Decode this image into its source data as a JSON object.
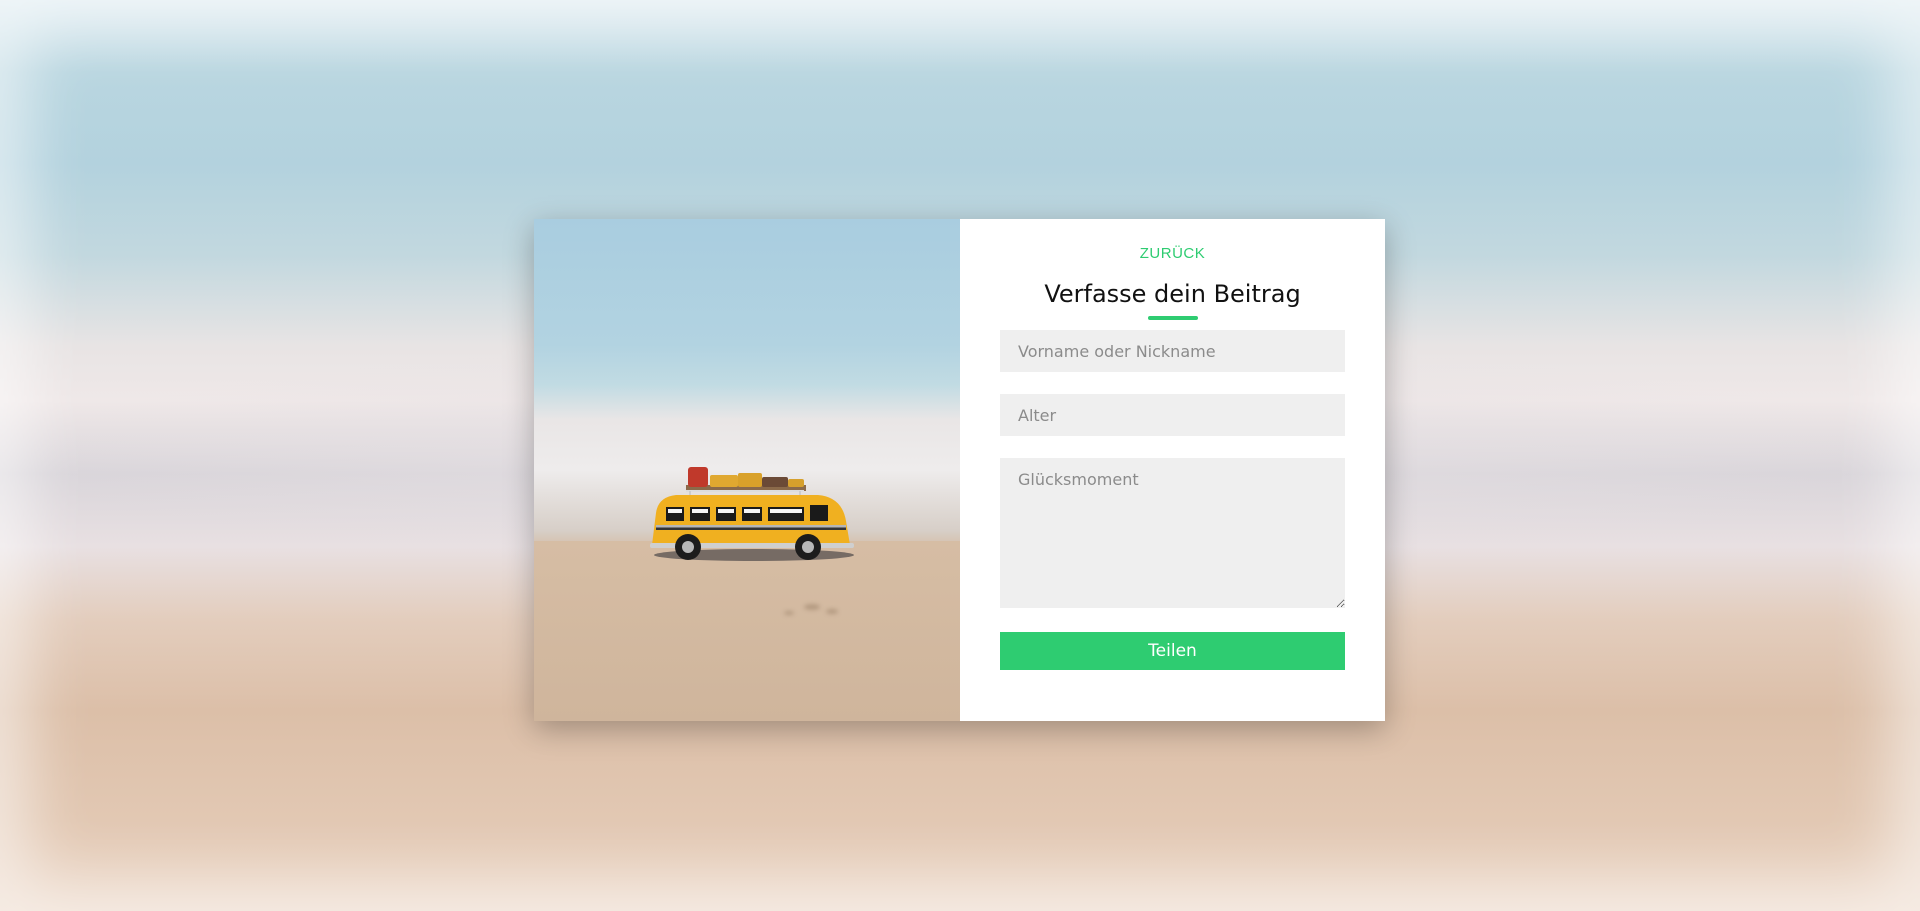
{
  "page": {
    "accent_color": "#2ecc71"
  },
  "photo": {
    "icon": "toy-bus-image"
  },
  "form": {
    "back_label": "ZURÜCK",
    "title": "Verfasse dein Beitrag",
    "name_placeholder": "Vorname oder Nickname",
    "name_value": "",
    "age_placeholder": "Alter",
    "age_value": "",
    "moment_placeholder": "Glücksmoment",
    "moment_value": "",
    "submit_label": "Teilen"
  }
}
